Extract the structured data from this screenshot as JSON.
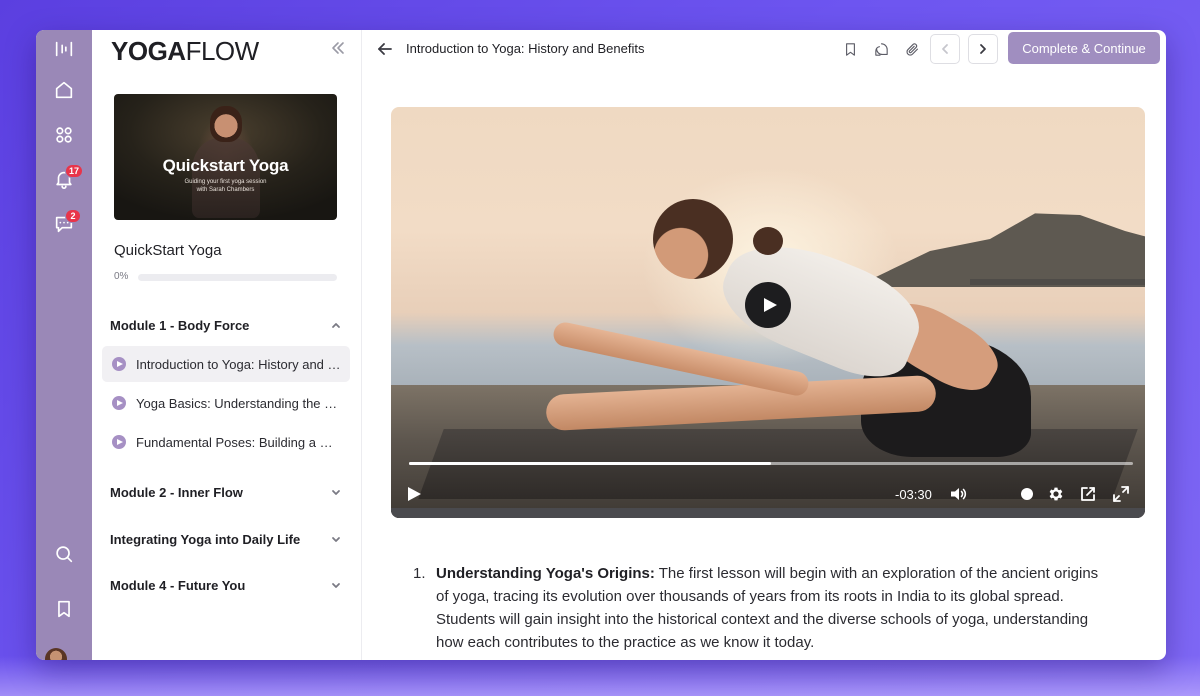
{
  "app": {
    "logo_bold": "YOGA",
    "logo_light": "FLOW"
  },
  "rail": {
    "notifications_count": "17",
    "messages_count": "2"
  },
  "course": {
    "thumbnail_title": "Quickstart Yoga",
    "thumbnail_subtitle_1": "Guiding your first yoga session",
    "thumbnail_subtitle_2": "with Sarah Chambers",
    "title": "QuickStart Yoga",
    "progress_label": "0%",
    "progress_value": 0
  },
  "modules": [
    {
      "label": "Module 1 - Body Force",
      "expanded": true,
      "lessons": [
        {
          "label": "Introduction to Yoga: History and Benefits",
          "active": true
        },
        {
          "label": "Yoga Basics: Understanding the Fundamentals",
          "active": false
        },
        {
          "label": "Fundamental Poses: Building a Strong Foundation",
          "active": false
        }
      ]
    },
    {
      "label": "Module 2 - Inner Flow",
      "expanded": false
    },
    {
      "label": "Integrating Yoga into Daily Life",
      "expanded": false
    },
    {
      "label": "Module 4 - Future You",
      "expanded": false
    }
  ],
  "header": {
    "lesson_title": "Introduction to Yoga: History and Benefits",
    "complete_label": "Complete & Continue"
  },
  "video": {
    "time_remaining": "-03:30",
    "progress_fraction": 0.5
  },
  "content": {
    "item_number": "1.",
    "item_heading": "Understanding Yoga's Origins:",
    "item_body": " The first lesson will begin with an exploration of the ancient origins of yoga, tracing its evolution over thousands of years from its roots in India to its global spread. Students will gain insight into the historical context and the diverse schools of yoga, understanding how each contributes to the practice as we know it today."
  },
  "colors": {
    "accent": "#9a88b7",
    "button": "#a08ec0",
    "badge": "#e8344a"
  }
}
